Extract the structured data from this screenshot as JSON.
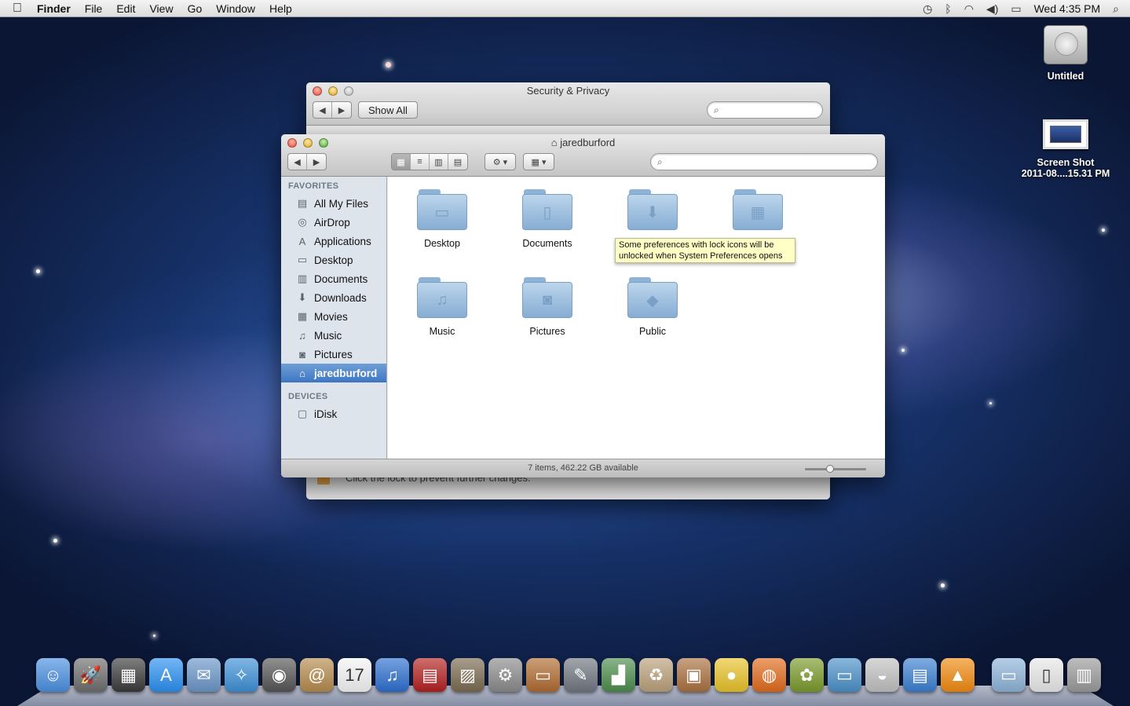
{
  "menubar": {
    "apple": "",
    "app_name": "Finder",
    "items": [
      "File",
      "Edit",
      "View",
      "Go",
      "Window",
      "Help"
    ],
    "clock": "Wed 4:35 PM",
    "status_icons": [
      "time-machine-icon",
      "bluetooth-icon",
      "wifi-icon",
      "volume-icon",
      "battery-icon",
      "spotlight-icon"
    ]
  },
  "desktop": {
    "icons": [
      {
        "label": "Untitled",
        "icon": "hard-drive-icon"
      },
      {
        "label_line1": "Screen Shot",
        "label_line2": "2011-08....15.31 PM",
        "icon": "screenshot-icon"
      }
    ]
  },
  "security_window": {
    "title": "Security & Privacy",
    "show_all": "Show All",
    "search_placeholder": "",
    "footer_text": "Click the lock to prevent further changes."
  },
  "finder_window": {
    "title": "jaredburford",
    "search_placeholder": "",
    "sidebar": {
      "favorites_header": "FAVORITES",
      "favorites": [
        {
          "label": "All My Files",
          "icon": "all-files-icon",
          "glyph": "▤"
        },
        {
          "label": "AirDrop",
          "icon": "airdrop-icon",
          "glyph": "◎"
        },
        {
          "label": "Applications",
          "icon": "applications-icon",
          "glyph": "A"
        },
        {
          "label": "Desktop",
          "icon": "desktop-icon",
          "glyph": "▭"
        },
        {
          "label": "Documents",
          "icon": "documents-icon",
          "glyph": "▥"
        },
        {
          "label": "Downloads",
          "icon": "downloads-icon",
          "glyph": "⬇"
        },
        {
          "label": "Movies",
          "icon": "movies-icon",
          "glyph": "▦"
        },
        {
          "label": "Music",
          "icon": "music-icon",
          "glyph": "♫"
        },
        {
          "label": "Pictures",
          "icon": "pictures-icon",
          "glyph": "◙"
        },
        {
          "label": "jaredburford",
          "icon": "home-icon",
          "glyph": "⌂",
          "selected": true
        }
      ],
      "devices_header": "DEVICES",
      "devices": [
        {
          "label": "iDisk",
          "icon": "idisk-icon",
          "glyph": "▢"
        }
      ]
    },
    "folders": [
      {
        "label": "Desktop",
        "glyph": "▭"
      },
      {
        "label": "Documents",
        "glyph": "▯"
      },
      {
        "label": "",
        "glyph": "⬇"
      },
      {
        "label": "",
        "glyph": "▦"
      },
      {
        "label": "Music",
        "glyph": "♫"
      },
      {
        "label": "Pictures",
        "glyph": "◙"
      },
      {
        "label": "Public",
        "glyph": "◆"
      }
    ],
    "status": "7 items, 462.22 GB available",
    "icon_size_level": 0.4
  },
  "tooltip": {
    "line1": "Some preferences with lock icons will be",
    "line2": "unlocked when System Preferences opens"
  },
  "dock": {
    "apps": [
      {
        "name": "finder-icon",
        "glyph": "☺",
        "color": "#4a8fe0"
      },
      {
        "name": "launchpad-icon",
        "glyph": "🚀",
        "color": "#6d6d6d"
      },
      {
        "name": "mission-control-icon",
        "glyph": "▦",
        "color": "#3a3a3a"
      },
      {
        "name": "app-store-icon",
        "glyph": "A",
        "color": "#2a8ff0"
      },
      {
        "name": "mail-icon",
        "glyph": "✉",
        "color": "#6a95c8"
      },
      {
        "name": "safari-icon",
        "glyph": "✧",
        "color": "#3d8fd6"
      },
      {
        "name": "facetime-icon",
        "glyph": "◉",
        "color": "#555"
      },
      {
        "name": "address-book-icon",
        "glyph": "@",
        "color": "#b48a4c"
      },
      {
        "name": "ical-icon",
        "glyph": "17",
        "color": "#f4f4f4"
      },
      {
        "name": "itunes-icon",
        "glyph": "♫",
        "color": "#2d6fd0"
      },
      {
        "name": "photo-booth-icon",
        "glyph": "▤",
        "color": "#b32020"
      },
      {
        "name": "iphoto-icon",
        "glyph": "▨",
        "color": "#7a6a50"
      },
      {
        "name": "system-preferences-icon",
        "glyph": "⚙",
        "color": "#8a8a8a"
      },
      {
        "name": "keynote-icon",
        "glyph": "▭",
        "color": "#b06b30"
      },
      {
        "name": "script-editor-icon",
        "glyph": "✎",
        "color": "#707680"
      },
      {
        "name": "numbers-icon",
        "glyph": "▟",
        "color": "#4c8c4c"
      },
      {
        "name": "archive-utility-icon",
        "glyph": "♻",
        "color": "#b9a07a"
      },
      {
        "name": "compress-icon",
        "glyph": "▣",
        "color": "#a9703f"
      },
      {
        "name": "cyberduck-icon",
        "glyph": "●",
        "color": "#e8c22a"
      },
      {
        "name": "firefox-icon",
        "glyph": "◍",
        "color": "#e06a1c"
      },
      {
        "name": "tropical-app-icon",
        "glyph": "✿",
        "color": "#7a9a2a"
      },
      {
        "name": "screen-sharing-icon",
        "glyph": "▭",
        "color": "#4a90c8"
      },
      {
        "name": "disk-utility-icon",
        "glyph": "◒",
        "color": "#c0c0c0"
      },
      {
        "name": "toolbox-icon",
        "glyph": "▤",
        "color": "#3a7fd0"
      },
      {
        "name": "vlc-icon",
        "glyph": "▲",
        "color": "#f08a10"
      }
    ],
    "stacks": [
      {
        "name": "downloads-stack-icon",
        "glyph": "▭",
        "color": "#8db3d8"
      },
      {
        "name": "document-stack-icon",
        "glyph": "▯",
        "color": "#e8e8e8"
      },
      {
        "name": "trash-icon",
        "glyph": "▥",
        "color": "#9a9a9a"
      }
    ]
  }
}
